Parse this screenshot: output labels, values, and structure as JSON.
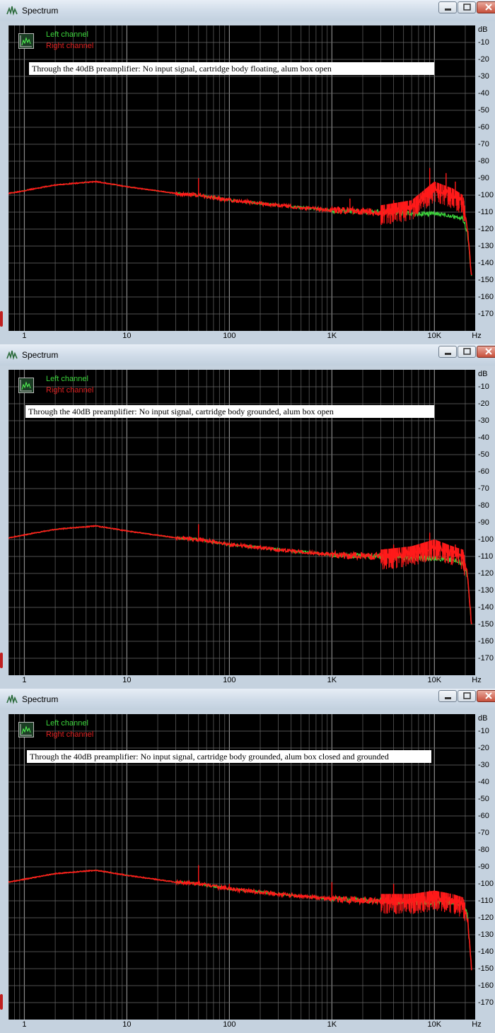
{
  "app": {
    "window_title": "Spectrum"
  },
  "colors": {
    "left_channel": "#3cd63c",
    "right_channel": "#ff1a1a",
    "plot_bg": "#000000",
    "grid": "#5a5a5a"
  },
  "axes": {
    "y_unit": "dB",
    "y_ticks": [
      "-10",
      "-20",
      "-30",
      "-40",
      "-50",
      "-60",
      "-70",
      "-80",
      "-90",
      "-100",
      "-110",
      "-120",
      "-130",
      "-140",
      "-150",
      "-160",
      "-170"
    ],
    "x_unit": "Hz",
    "x_ticks": [
      "1",
      "10",
      "100",
      "1K",
      "10K"
    ]
  },
  "legend": {
    "left": "Left channel",
    "right": "Right channel"
  },
  "windows": [
    {
      "annotation": "Through the 40dB preamplifier: No input signal, cartridge body floating, alum box open"
    },
    {
      "annotation": "Through the 40dB preamplifier: No input signal, cartridge body grounded, alum box open"
    },
    {
      "annotation": "Through the 40dB preamplifier: No input signal, cartridge body grounded, alum box closed and grounded"
    }
  ],
  "chart_data": [
    {
      "type": "line",
      "title": "Through the 40dB preamplifier: No input signal, cartridge body floating, alum box open",
      "xlabel": "Hz",
      "ylabel": "dB",
      "x_scale": "log",
      "xlim": [
        0.7,
        25000
      ],
      "ylim": [
        -180,
        0
      ],
      "grid": true,
      "legend_position": "top-left",
      "series": [
        {
          "name": "Left channel",
          "x": [
            0.7,
            2,
            5,
            10,
            30,
            50,
            100,
            300,
            1000,
            3000,
            6000,
            10000,
            15000,
            19000,
            21000,
            23000
          ],
          "y": [
            -99,
            -94,
            -92,
            -95,
            -99,
            -100,
            -103,
            -106,
            -109,
            -110,
            -111,
            -111,
            -112,
            -114,
            -122,
            -148
          ]
        },
        {
          "name": "Right channel",
          "x": [
            0.7,
            2,
            5,
            10,
            30,
            50,
            100,
            300,
            1000,
            3000,
            6000,
            10000,
            15000,
            19000,
            21000,
            23000
          ],
          "y": [
            -99,
            -94,
            -92,
            -95,
            -99,
            -100,
            -103,
            -106,
            -109,
            -110,
            -107,
            -96,
            -100,
            -104,
            -120,
            -148
          ],
          "peaks": [
            {
              "x": 50,
              "y": -90
            },
            {
              "x": 1500,
              "y": -102
            },
            {
              "x": 4000,
              "y": -103
            },
            {
              "x": 9000,
              "y": -84
            },
            {
              "x": 13000,
              "y": -87
            },
            {
              "x": 16000,
              "y": -92
            }
          ]
        }
      ]
    },
    {
      "type": "line",
      "title": "Through the 40dB preamplifier: No input signal, cartridge body grounded, alum box open",
      "xlabel": "Hz",
      "ylabel": "dB",
      "x_scale": "log",
      "xlim": [
        0.7,
        25000
      ],
      "ylim": [
        -180,
        0
      ],
      "grid": true,
      "legend_position": "top-left",
      "series": [
        {
          "name": "Left channel",
          "x": [
            0.7,
            2,
            5,
            10,
            30,
            50,
            100,
            300,
            1000,
            3000,
            6000,
            10000,
            15000,
            19000,
            21000,
            23000
          ],
          "y": [
            -99,
            -94,
            -92,
            -95,
            -99,
            -100,
            -103,
            -106,
            -109,
            -110,
            -111,
            -111,
            -112,
            -114,
            -122,
            -150
          ]
        },
        {
          "name": "Right channel",
          "x": [
            0.7,
            2,
            5,
            10,
            30,
            50,
            100,
            300,
            1000,
            3000,
            6000,
            10000,
            15000,
            19000,
            21000,
            23000
          ],
          "y": [
            -99,
            -94,
            -92,
            -95,
            -99,
            -100,
            -103,
            -106,
            -109,
            -110,
            -108,
            -104,
            -108,
            -110,
            -120,
            -150
          ],
          "peaks": [
            {
              "x": 50,
              "y": -91
            },
            {
              "x": 4000,
              "y": -103
            },
            {
              "x": 9000,
              "y": -96
            },
            {
              "x": 16000,
              "y": -103
            }
          ]
        }
      ]
    },
    {
      "type": "line",
      "title": "Through the 40dB preamplifier: No input signal, cartridge body grounded, alum box closed and grounded",
      "xlabel": "Hz",
      "ylabel": "dB",
      "x_scale": "log",
      "xlim": [
        0.7,
        25000
      ],
      "ylim": [
        -180,
        0
      ],
      "grid": true,
      "legend_position": "top-left",
      "series": [
        {
          "name": "Left channel",
          "x": [
            0.7,
            2,
            5,
            10,
            30,
            50,
            100,
            300,
            1000,
            3000,
            6000,
            10000,
            15000,
            19000,
            21000,
            23000
          ],
          "y": [
            -99,
            -94,
            -92,
            -95,
            -99,
            -100,
            -103,
            -106,
            -109,
            -110,
            -111,
            -111,
            -111,
            -112,
            -118,
            -150
          ]
        },
        {
          "name": "Right channel",
          "x": [
            0.7,
            2,
            5,
            10,
            30,
            50,
            100,
            300,
            1000,
            3000,
            6000,
            10000,
            15000,
            19000,
            21000,
            23000
          ],
          "y": [
            -99,
            -94,
            -92,
            -95,
            -99,
            -100,
            -103,
            -106,
            -109,
            -110,
            -110,
            -108,
            -110,
            -112,
            -120,
            -150
          ],
          "peaks": [
            {
              "x": 50,
              "y": -89
            },
            {
              "x": 100,
              "y": -100
            },
            {
              "x": 1000,
              "y": -99
            },
            {
              "x": 4000,
              "y": -100
            },
            {
              "x": 9000,
              "y": -104
            }
          ]
        }
      ]
    }
  ]
}
